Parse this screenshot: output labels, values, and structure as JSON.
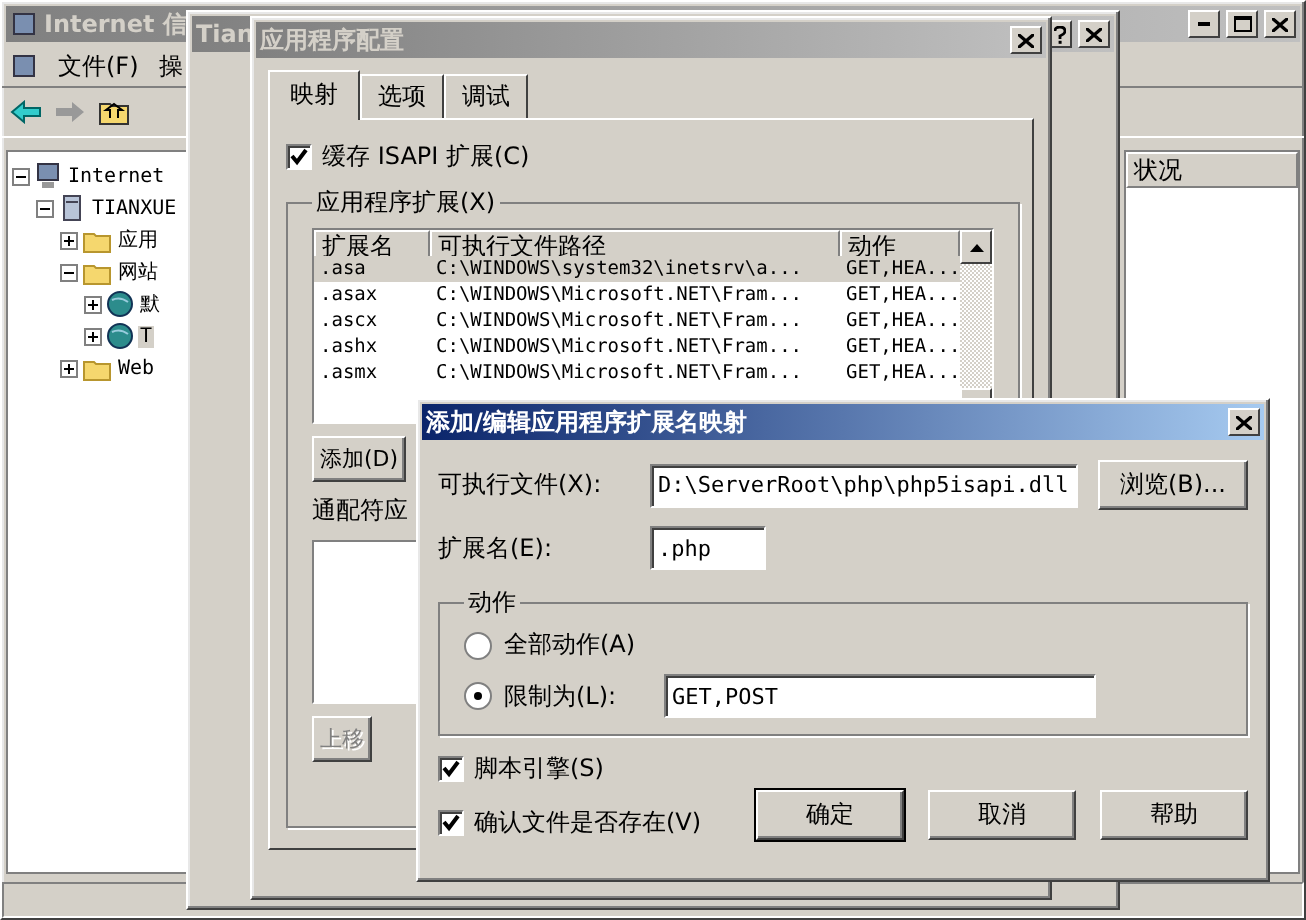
{
  "main_window": {
    "title": "Internet 信",
    "menu": [
      "文件(F)",
      "操"
    ],
    "tree": [
      {
        "label": "Internet",
        "kind": "computer",
        "expanded": true,
        "selected": false,
        "children": [
          {
            "label": "TIANXUE",
            "kind": "server",
            "expanded": true,
            "selected": false,
            "children": [
              {
                "label": "应用",
                "kind": "folder",
                "expanded": false,
                "selected": false
              },
              {
                "label": "网站",
                "kind": "folder",
                "expanded": true,
                "selected": false,
                "children": [
                  {
                    "label": "默",
                    "kind": "globe",
                    "expanded": false,
                    "selected": false
                  },
                  {
                    "label": "T",
                    "kind": "globe",
                    "expanded": false,
                    "selected": true
                  }
                ]
              },
              {
                "label": "Web",
                "kind": "folder",
                "expanded": false,
                "selected": false
              }
            ]
          }
        ]
      }
    ],
    "columns": [
      "状况"
    ]
  },
  "properties_window": {
    "title": "Tian"
  },
  "config_window": {
    "title": "应用程序配置",
    "tabs": [
      {
        "label": "映射",
        "selected": true
      },
      {
        "label": "选项",
        "selected": false
      },
      {
        "label": "调试",
        "selected": false
      }
    ],
    "cache_isapi": {
      "label": "缓存 ISAPI 扩展(C)",
      "checked": true
    },
    "extensions": {
      "label": "应用程序扩展(X)",
      "columns": [
        "扩展名",
        "可执行文件路径",
        "动作"
      ],
      "rows": [
        {
          "extension": ".asa",
          "path": "C:\\WINDOWS\\system32\\inetsrv\\a...",
          "verbs": "GET,HEA...",
          "selected": true
        },
        {
          "extension": ".asax",
          "path": "C:\\WINDOWS\\Microsoft.NET\\Fram...",
          "verbs": "GET,HEA...",
          "selected": false
        },
        {
          "extension": ".ascx",
          "path": "C:\\WINDOWS\\Microsoft.NET\\Fram...",
          "verbs": "GET,HEA...",
          "selected": false
        },
        {
          "extension": ".ashx",
          "path": "C:\\WINDOWS\\Microsoft.NET\\Fram...",
          "verbs": "GET,HEA...",
          "selected": false
        },
        {
          "extension": ".asmx",
          "path": "C:\\WINDOWS\\Microsoft.NET\\Fram...",
          "verbs": "GET,HEA...",
          "selected": false
        }
      ]
    },
    "add_button": "添加(D)",
    "wildcard_label": "通配符应",
    "move_up_button": {
      "label": "上移",
      "disabled": true
    }
  },
  "add_dialog": {
    "title": "添加/编辑应用程序扩展名映射",
    "executable": {
      "label": "可执行文件(X):",
      "value": "D:\\ServerRoot\\php\\php5isapi.dll"
    },
    "browse_button": "浏览(B)...",
    "extension": {
      "label": "扩展名(E):",
      "value": ".php"
    },
    "verbs": {
      "label": "动作",
      "options": [
        {
          "label": "全部动作(A)",
          "selected": false
        },
        {
          "label": "限制为(L):",
          "selected": true
        }
      ],
      "limit_value": "GET,POST"
    },
    "script_engine": {
      "label": "脚本引擎(S)",
      "checked": true
    },
    "verify_file": {
      "label": "确认文件是否存在(V)",
      "checked": true
    },
    "buttons": [
      "确定",
      "取消",
      "帮助"
    ]
  }
}
